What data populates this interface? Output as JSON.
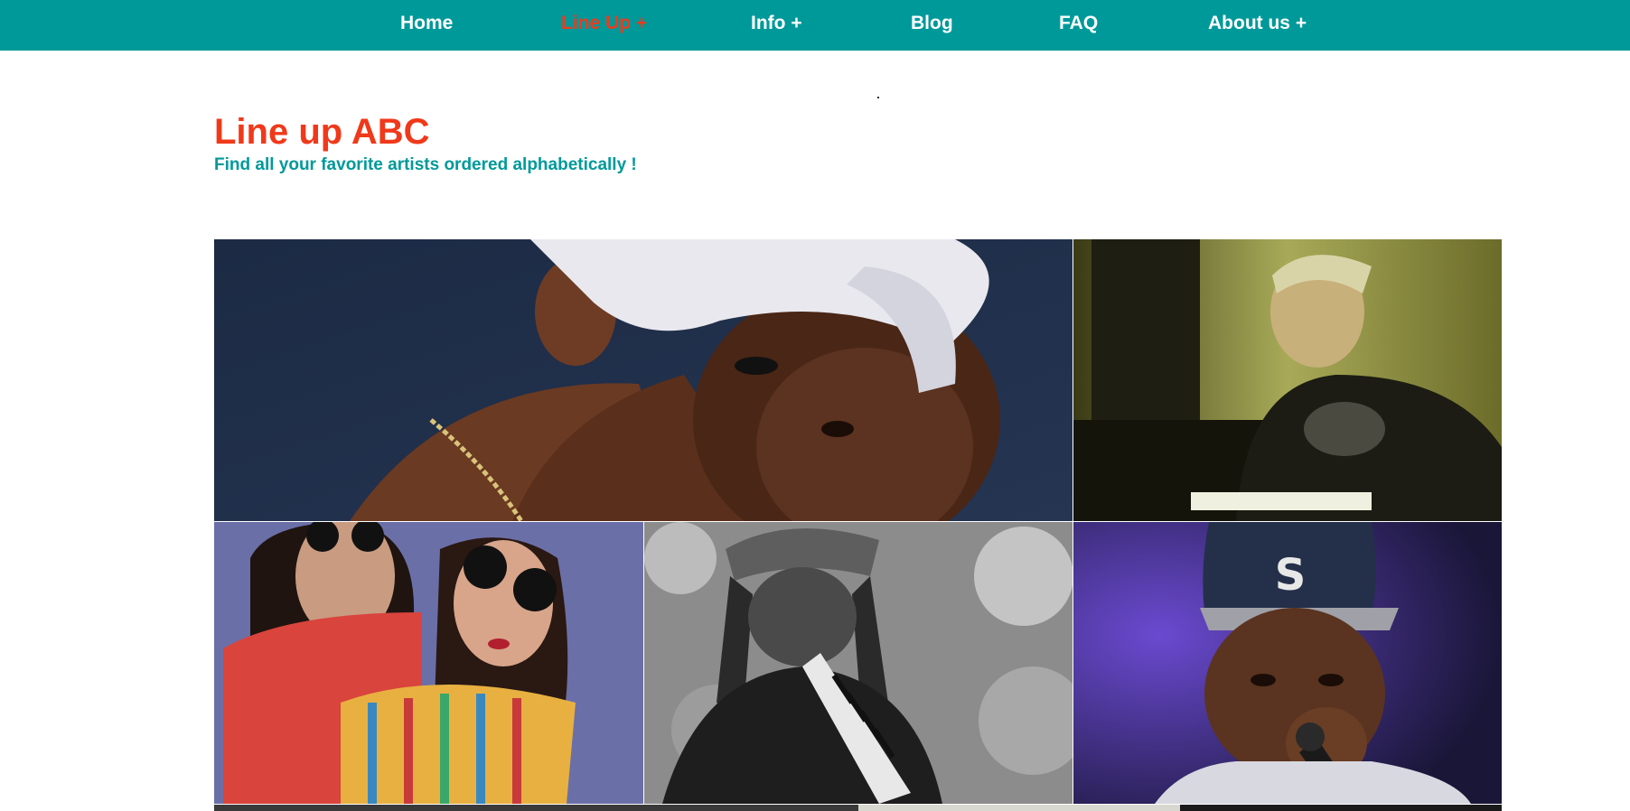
{
  "nav": {
    "items": [
      {
        "label": "Home",
        "active": false
      },
      {
        "label": "Line Up +",
        "active": true
      },
      {
        "label": "Info +",
        "active": false
      },
      {
        "label": "Blog",
        "active": false
      },
      {
        "label": "FAQ",
        "active": false
      },
      {
        "label": "About us +",
        "active": false
      }
    ]
  },
  "page": {
    "title": "Line up ABC",
    "subtitle": "Find all your favorite artists ordered alphabetically !"
  },
  "artists": [
    {
      "image": "portrait-bandana-photo"
    },
    {
      "image": "musician-keyboard-photo"
    },
    {
      "image": "duo-sunglasses-photo"
    },
    {
      "image": "melodica-player-photo"
    },
    {
      "image": "rapper-microphone-photo"
    }
  ],
  "colors": {
    "nav_background": "#00999a",
    "accent_red": "#f0391a",
    "accent_teal": "#00999a"
  }
}
